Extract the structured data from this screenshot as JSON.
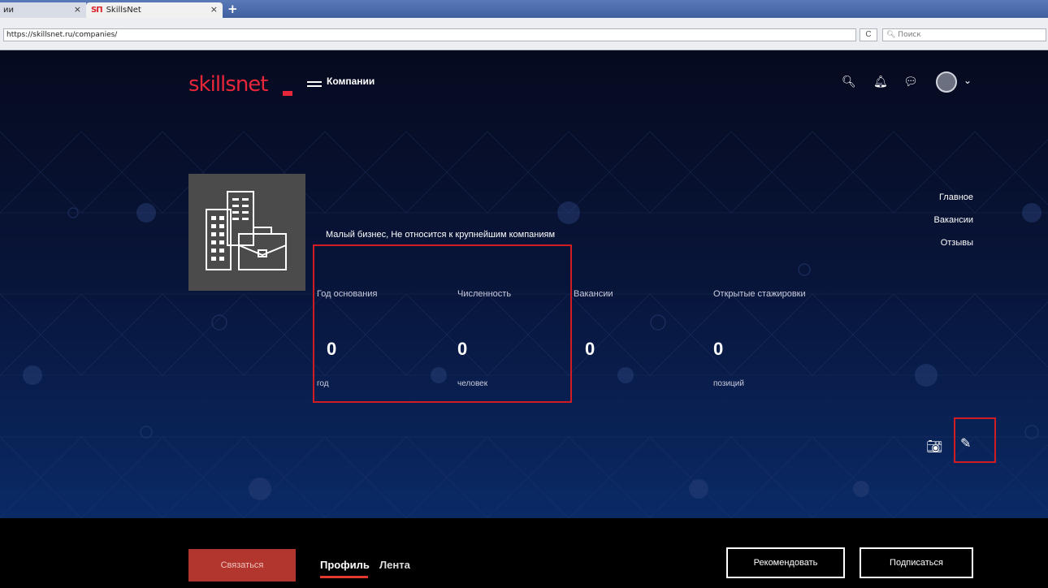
{
  "browser": {
    "tabs": [
      {
        "label": "ии"
      },
      {
        "label": "SkillsNet"
      }
    ],
    "favicon_text": "SΠ",
    "new_tab": "+",
    "close_symbol": "×",
    "url": "https://skillsnet.ru/companies/",
    "search_placeholder": "Поиск"
  },
  "header": {
    "logo_text": "skillsnet",
    "menu_label": "Компании"
  },
  "company": {
    "type_text": "Малый бизнес, Не относится к крупнейшим компаниям"
  },
  "stats": [
    {
      "label": "Год основания",
      "value": "0",
      "unit": "год"
    },
    {
      "label": "Численность",
      "value": "0",
      "unit": "человек"
    },
    {
      "label": "Вакансии",
      "value": "0",
      "unit": ""
    },
    {
      "label": "Открытые стажировки",
      "value": "0",
      "unit": "позиций"
    }
  ],
  "side_nav": [
    {
      "label": "Главное"
    },
    {
      "label": "Вакансии"
    },
    {
      "label": "Отзывы"
    }
  ],
  "bottom": {
    "contact_button": "Связаться",
    "tab_profile": "Профиль",
    "tab_feed": "Лента",
    "recommend_button": "Рекомендовать",
    "subscribe_button": "Подписаться"
  },
  "colors": {
    "brand": "#e8263a",
    "highlight": "#d21c23",
    "contact_button": "#b3362e"
  }
}
